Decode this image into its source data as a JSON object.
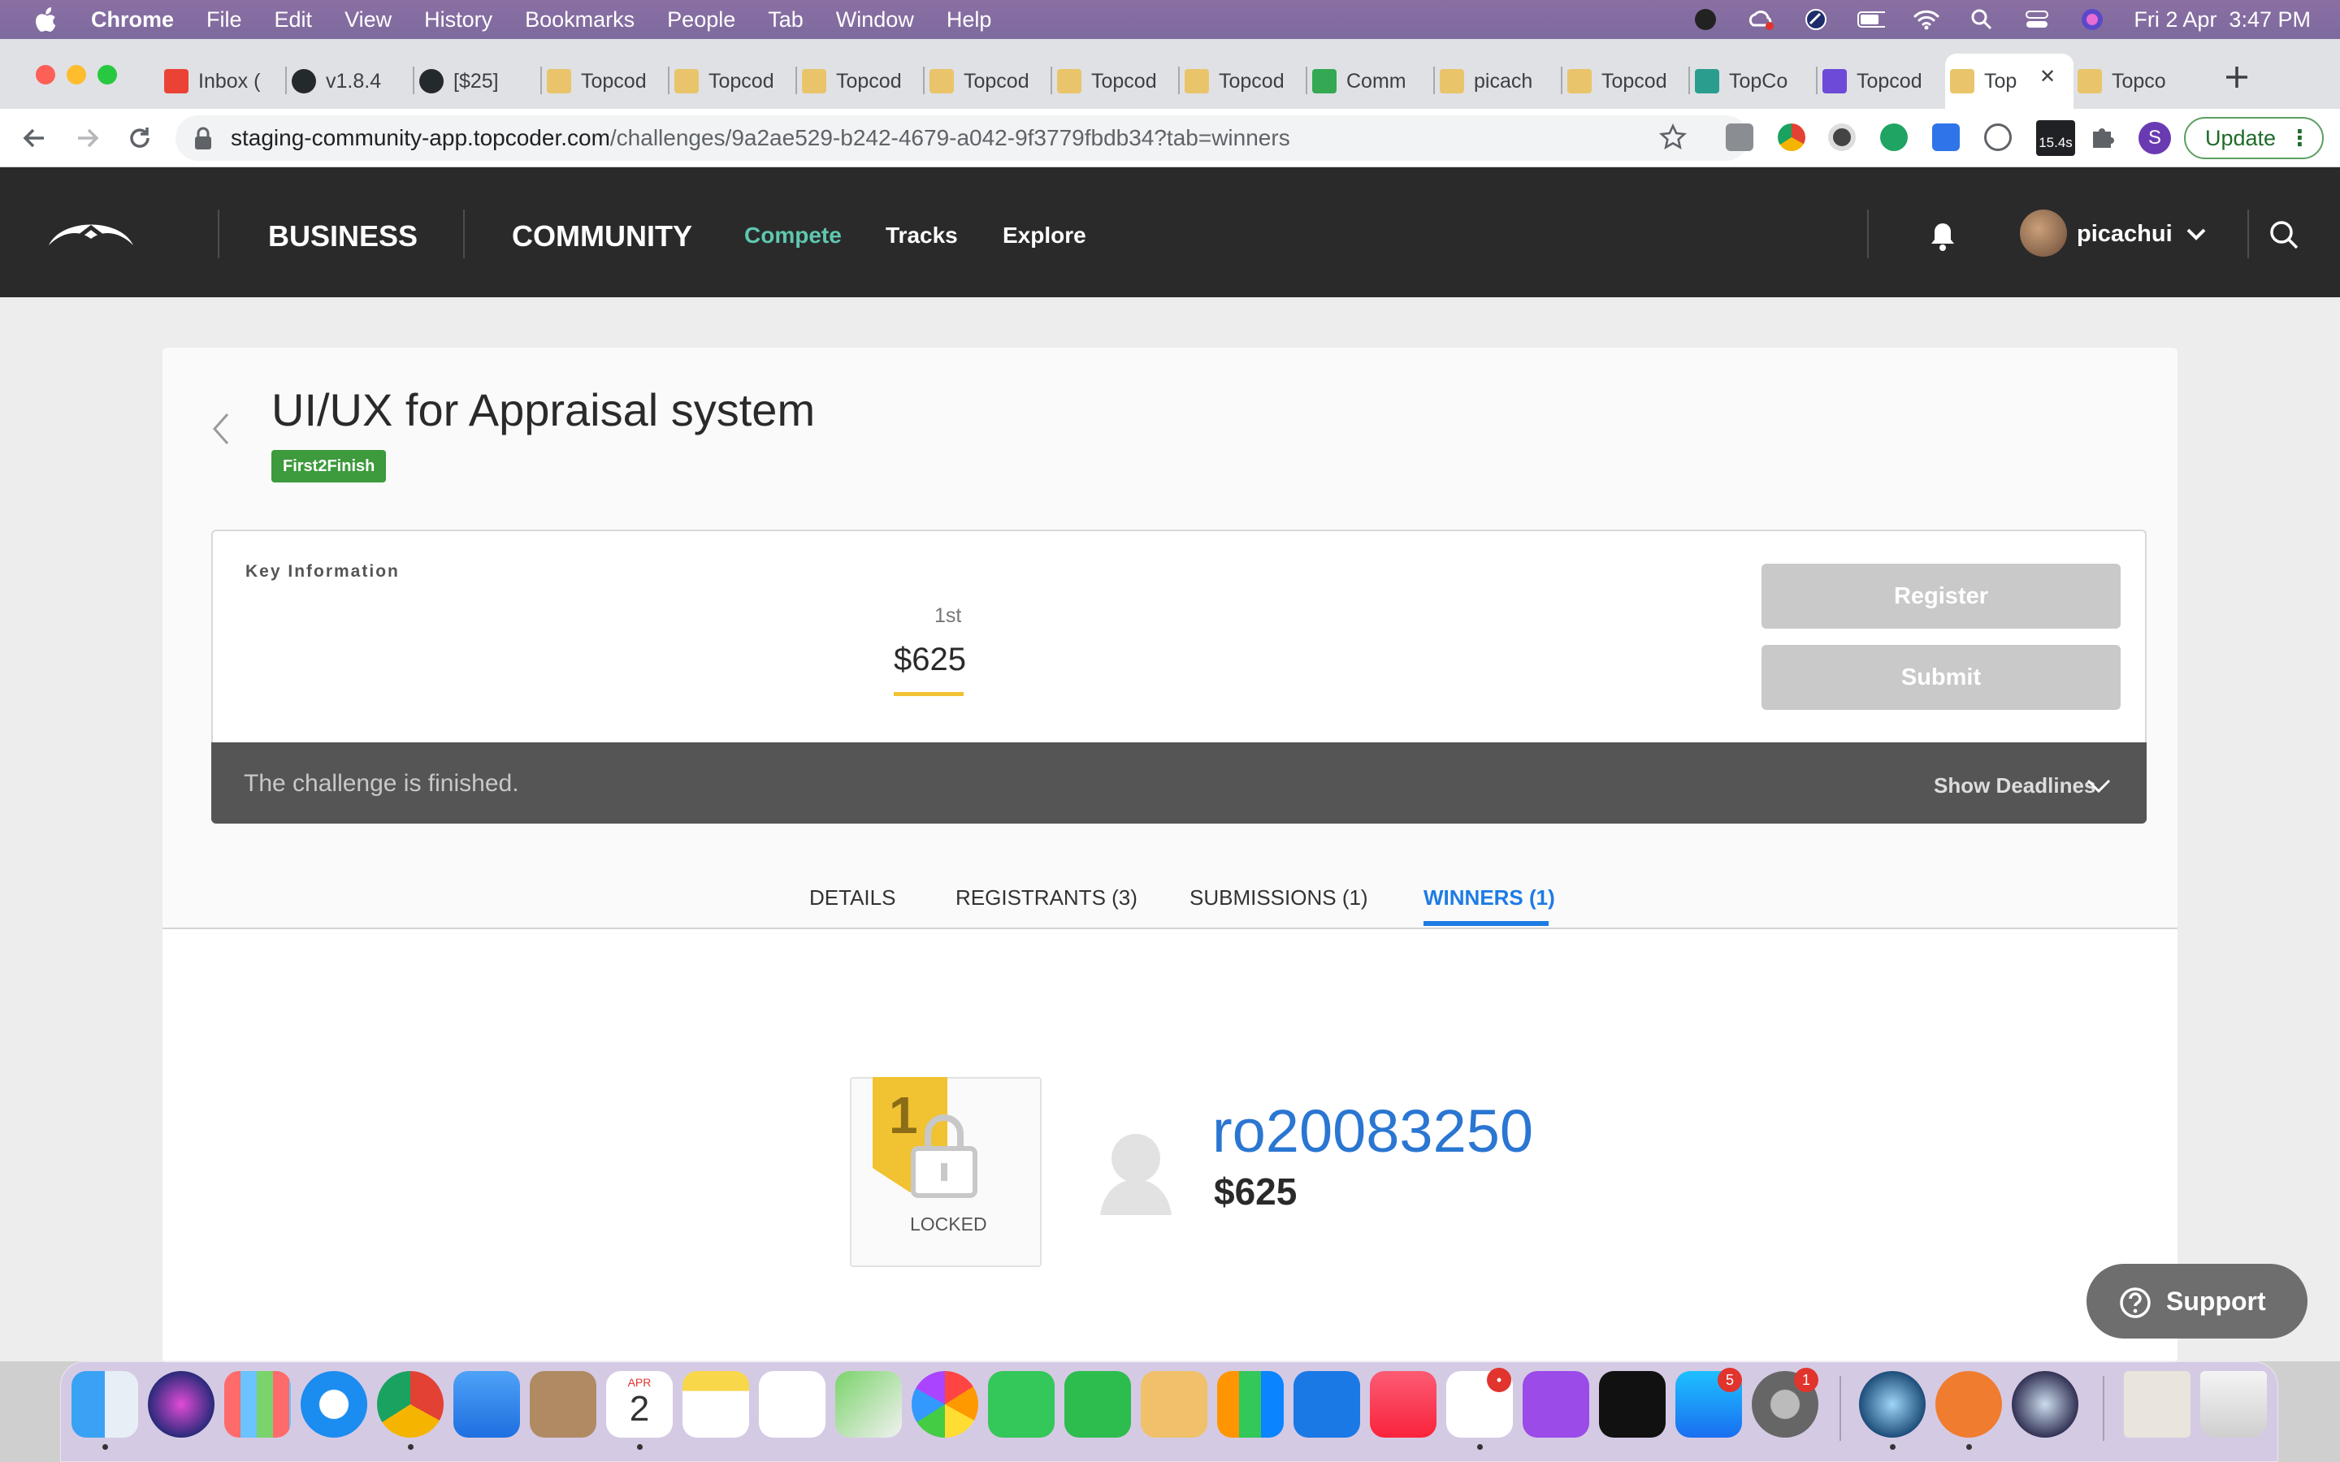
{
  "menubar": {
    "app_name": "Chrome",
    "items": [
      "File",
      "Edit",
      "View",
      "History",
      "Bookmarks",
      "People",
      "Tab",
      "Window",
      "Help"
    ],
    "datetime": "Fri 2 Apr  3:47 PM"
  },
  "browser": {
    "tabs": [
      {
        "title": "Inbox (",
        "icon": "gmail-icon"
      },
      {
        "title": "v1.8.4",
        "icon": "github-icon"
      },
      {
        "title": "[$25] ",
        "icon": "github-icon"
      },
      {
        "title": "Topcod",
        "icon": "topcoder-favicon-icon"
      },
      {
        "title": "Topcod",
        "icon": "topcoder-favicon-icon"
      },
      {
        "title": "Topcod",
        "icon": "topcoder-favicon-icon"
      },
      {
        "title": "Topcod",
        "icon": "topcoder-favicon-icon"
      },
      {
        "title": "Topcod",
        "icon": "topcoder-favicon-icon"
      },
      {
        "title": "Topcod",
        "icon": "topcoder-favicon-icon"
      },
      {
        "title": "Comm",
        "icon": "community-favicon-icon"
      },
      {
        "title": "picach",
        "icon": "topcoder-favicon-icon"
      },
      {
        "title": "Topcod",
        "icon": "topcoder-favicon-icon"
      },
      {
        "title": "TopCo",
        "icon": "topcoder-arch-favicon-icon"
      },
      {
        "title": "Topcod",
        "icon": "topcoder-wave-favicon-icon"
      },
      {
        "title": "Top",
        "icon": "topcoder-favicon-icon",
        "active": true
      },
      {
        "title": "Topco",
        "icon": "topcoder-favicon-icon"
      }
    ],
    "url_domain": "staging-community-app.topcoder.com",
    "url_path": "/challenges/9a2ae529-b242-4679-a042-9f3779fbdb34?tab=winners",
    "extension_timer": "15.4s",
    "profile_initial": "S",
    "update_label": "Update"
  },
  "site_header": {
    "business": "BUSINESS",
    "community": "COMMUNITY",
    "nav": [
      "Compete",
      "Tracks",
      "Explore"
    ],
    "active_nav": "Compete",
    "username": "picachui"
  },
  "challenge": {
    "title": "UI/UX for Appraisal system",
    "type_badge": "First2Finish",
    "key_info_label": "Key Information",
    "prize_place": "1st",
    "prize_amount": "$625",
    "register_label": "Register",
    "submit_label": "Submit",
    "status_text": "The challenge is finished.",
    "show_deadlines": "Show Deadlines"
  },
  "tabs": [
    "DETAILS",
    "REGISTRANTS (3)",
    "SUBMISSIONS (1)",
    "WINNERS (1)"
  ],
  "active_tab": "WINNERS (1)",
  "winner": {
    "place": "1",
    "submission_status": "LOCKED",
    "handle": "ro20083250",
    "prize": "$625"
  },
  "support_label": "Support",
  "dock": {
    "calendar_month": "APR",
    "calendar_day": "2",
    "badges": {
      "slack": "•",
      "app_store": "5",
      "system_preferences": "1"
    }
  },
  "colors": {
    "header_bg": "#2a2a2a",
    "compete_accent": "#5fc7b0",
    "badge_green": "#3d9a3d",
    "link_blue": "#2a76d2",
    "tab_active": "#1e7be5",
    "ribbon_gold": "#f1c232"
  }
}
